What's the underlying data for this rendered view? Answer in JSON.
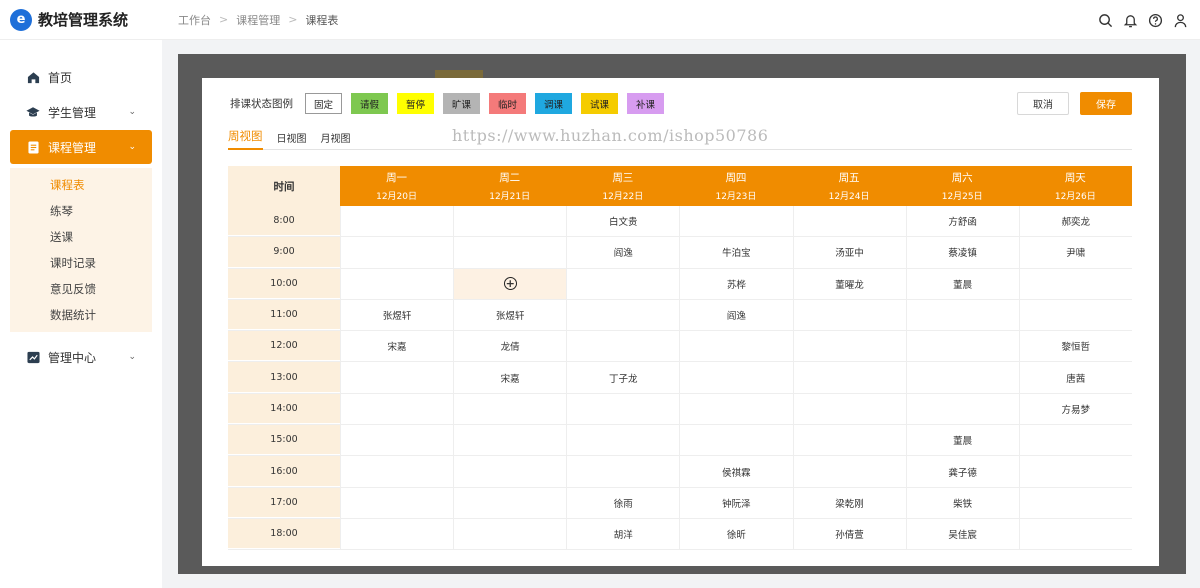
{
  "app": {
    "title": "教培管理系统",
    "logo_letter": "e"
  },
  "breadcrumb": [
    "工作台",
    "课程管理",
    "课程表"
  ],
  "sidebar": {
    "items": [
      {
        "label": "首页"
      },
      {
        "label": "学生管理"
      },
      {
        "label": "课程管理"
      },
      {
        "label": "管理中心"
      }
    ],
    "submenu": [
      "课程表",
      "练琴",
      "送课",
      "课时记录",
      "意见反馈",
      "数据统计"
    ]
  },
  "modal": {
    "legend_label": "排课状态图例",
    "legend": [
      {
        "label": "固定",
        "color": "#ffffff"
      },
      {
        "label": "请假",
        "color": "#7ec850"
      },
      {
        "label": "暂停",
        "color": "#ffff00"
      },
      {
        "label": "旷课",
        "color": "#b4b4b4"
      },
      {
        "label": "临时",
        "color": "#f47a7a"
      },
      {
        "label": "调课",
        "color": "#1fa8e0"
      },
      {
        "label": "试课",
        "color": "#f5cc00"
      },
      {
        "label": "补课",
        "color": "#d79cf0"
      }
    ],
    "cancel_label": "取消",
    "save_label": "保存",
    "tabs": [
      "周视图",
      "日视图",
      "月视图"
    ],
    "watermark": "https://www.huzhan.com/ishop50786"
  },
  "schedule": {
    "time_header": "时间",
    "days": [
      {
        "name": "周一",
        "date": "12月20日"
      },
      {
        "name": "周二",
        "date": "12月21日"
      },
      {
        "name": "周三",
        "date": "12月22日"
      },
      {
        "name": "周四",
        "date": "12月23日"
      },
      {
        "name": "周五",
        "date": "12月24日"
      },
      {
        "name": "周六",
        "date": "12月25日"
      },
      {
        "name": "周天",
        "date": "12月26日"
      }
    ],
    "rows": [
      {
        "time": "8:00",
        "cells": [
          "",
          "",
          "白文贵",
          "",
          "",
          "方舒函",
          "郝奕龙"
        ]
      },
      {
        "time": "9:00",
        "cells": [
          "",
          "",
          "阎逸",
          "牛泊宝",
          "汤亚中",
          "蔡凌镇",
          "尹啸"
        ]
      },
      {
        "time": "10:00",
        "cells": [
          "",
          "",
          "",
          "苏桦",
          "董曜龙",
          "董晨",
          ""
        ]
      },
      {
        "time": "11:00",
        "cells": [
          "张煜轩",
          "张煜轩",
          "",
          "阎逸",
          "",
          "",
          ""
        ]
      },
      {
        "time": "12:00",
        "cells": [
          "宋嘉",
          "龙倩",
          "",
          "",
          "",
          "",
          "黎恒哲"
        ]
      },
      {
        "time": "13:00",
        "cells": [
          "",
          "宋嘉",
          "丁子龙",
          "",
          "",
          "",
          "唐茜"
        ]
      },
      {
        "time": "14:00",
        "cells": [
          "",
          "",
          "",
          "",
          "",
          "",
          "方易梦"
        ]
      },
      {
        "time": "15:00",
        "cells": [
          "",
          "",
          "",
          "",
          "",
          "董晨",
          ""
        ]
      },
      {
        "time": "16:00",
        "cells": [
          "",
          "",
          "",
          "侯祺霖",
          "",
          "龚子德",
          ""
        ]
      },
      {
        "time": "17:00",
        "cells": [
          "",
          "",
          "徐雨",
          "钟阮泽",
          "梁乾刚",
          "柴铁",
          ""
        ]
      },
      {
        "time": "18:00",
        "cells": [
          "",
          "",
          "胡洋",
          "徐昕",
          "孙倩萱",
          "吴佳宸",
          ""
        ]
      }
    ],
    "add_slot": {
      "row": 2,
      "col": 1,
      "icon": "plus-circle-icon"
    }
  }
}
